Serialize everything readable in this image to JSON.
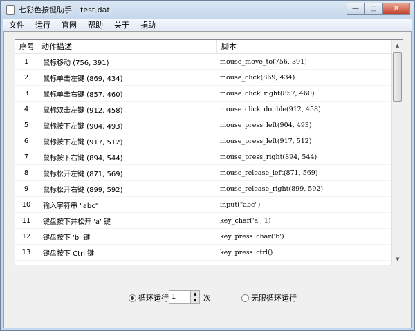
{
  "window": {
    "app_title": "七彩色按键助手",
    "file": "test.dat",
    "min": "—",
    "max": "□",
    "close": "✕"
  },
  "menu": [
    "文件",
    "运行",
    "官网",
    "帮助",
    "关于",
    "捐助"
  ],
  "table": {
    "headers": [
      "序号",
      "动作描述",
      "脚本"
    ],
    "rows": [
      [
        "1",
        "鼠标移动 (756, 391)",
        "mouse_move_to(756, 391)"
      ],
      [
        "2",
        "鼠标单击左键 (869, 434)",
        "mouse_click(869, 434)"
      ],
      [
        "3",
        "鼠标单击右键 (857, 460)",
        "mouse_click_right(857, 460)"
      ],
      [
        "4",
        "鼠标双击左键 (912, 458)",
        "mouse_click_double(912, 458)"
      ],
      [
        "5",
        "鼠标按下左键 (904, 493)",
        "mouse_press_left(904, 493)"
      ],
      [
        "6",
        "鼠标按下左键 (917, 512)",
        "mouse_press_left(917, 512)"
      ],
      [
        "7",
        "鼠标按下右键 (894, 544)",
        "mouse_press_right(894, 544)"
      ],
      [
        "8",
        "鼠标松开左键 (871, 569)",
        "mouse_release_left(871, 569)"
      ],
      [
        "9",
        "鼠标松开右键 (899, 592)",
        "mouse_release_right(899, 592)"
      ],
      [
        "10",
        "输入字符串 \"abc\"",
        "input(\"abc\")"
      ],
      [
        "11",
        "键盘按下并松开 'a' 键",
        "key_char('a', 1)"
      ],
      [
        "12",
        "键盘按下 'b' 键",
        "key_press_char('b')"
      ],
      [
        "13",
        "键盘按下 Ctrl 键",
        "key_press_ctrl()"
      ]
    ]
  },
  "bottom": {
    "loop_label": "循环运行",
    "loop_count": "1",
    "times": "次",
    "infinite_label": "无限循环运行",
    "loop_selected": true
  }
}
